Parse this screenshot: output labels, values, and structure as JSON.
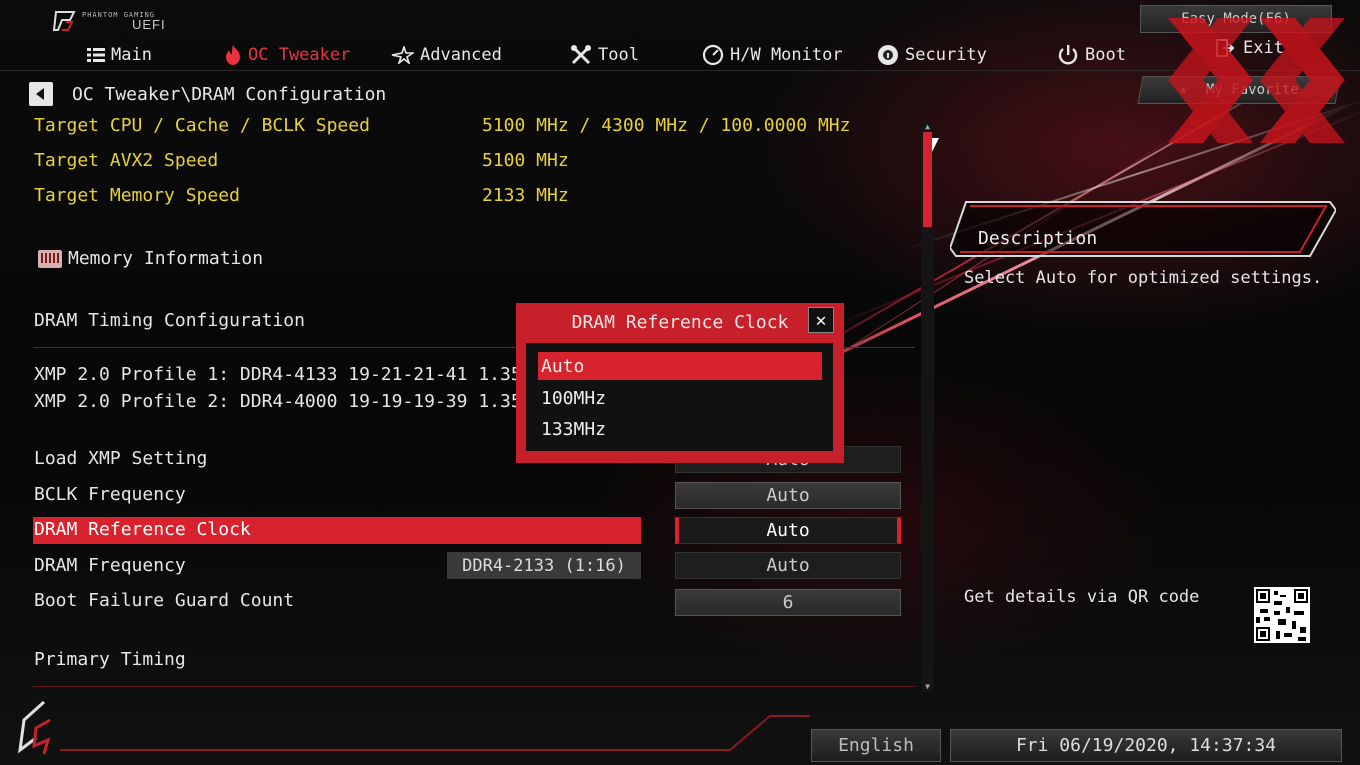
{
  "header": {
    "brand_small": "PHANTOM GAMING",
    "brand_uefi": "UEFI",
    "easy_mode": "Easy Mode(F6)",
    "my_favorite": "My Favorite",
    "exit": "Exit"
  },
  "menu": [
    {
      "label": "Main",
      "icon": "list-icon"
    },
    {
      "label": "OC Tweaker",
      "icon": "flame-icon",
      "active": true
    },
    {
      "label": "Advanced",
      "icon": "star-icon"
    },
    {
      "label": "Tool",
      "icon": "tools-icon"
    },
    {
      "label": "H/W Monitor",
      "icon": "monitor-icon"
    },
    {
      "label": "Security",
      "icon": "shield-icon"
    },
    {
      "label": "Boot",
      "icon": "power-icon"
    }
  ],
  "breadcrumb": "OC Tweaker\\DRAM Configuration",
  "targets": [
    {
      "label": "Target CPU / Cache / BCLK Speed",
      "value": "5100 MHz / 4300 MHz / 100.0000 MHz"
    },
    {
      "label": "Target AVX2 Speed",
      "value": "5100 MHz"
    },
    {
      "label": "Target Memory Speed",
      "value": "2133 MHz"
    }
  ],
  "memory_information": "Memory Information",
  "dram_timing_configuration": "DRAM Timing Configuration",
  "xmp_profiles": [
    "XMP 2.0 Profile 1: DDR4-4133 19-21-21-41 1.35V",
    "XMP 2.0 Profile 2: DDR4-4000 19-19-19-39 1.35V"
  ],
  "settings": [
    {
      "label": "Load XMP Setting",
      "value": "Auto"
    },
    {
      "label": "BCLK Frequency",
      "value": "Auto"
    },
    {
      "label": "DRAM Reference Clock",
      "value": "Auto"
    },
    {
      "label": "DRAM Frequency",
      "info": "DDR4-2133 (1:16)",
      "value": "Auto"
    },
    {
      "label": "Boot Failure Guard Count",
      "value": "6"
    }
  ],
  "primary_timing": "Primary Timing",
  "popup": {
    "title": "DRAM Reference Clock",
    "close": "✕",
    "options": [
      "Auto",
      "100MHz",
      "133MHz"
    ],
    "selected_index": 0
  },
  "description": {
    "title": "Description",
    "text": "Select Auto for optimized settings."
  },
  "qr_label": "Get details via QR code",
  "footer": {
    "language": "English",
    "datetime": "Fri 06/19/2020, 14:37:34"
  },
  "colors": {
    "accent": "#d8232f",
    "active_menu": "#e8343f",
    "target_text": "#e6d13b"
  }
}
